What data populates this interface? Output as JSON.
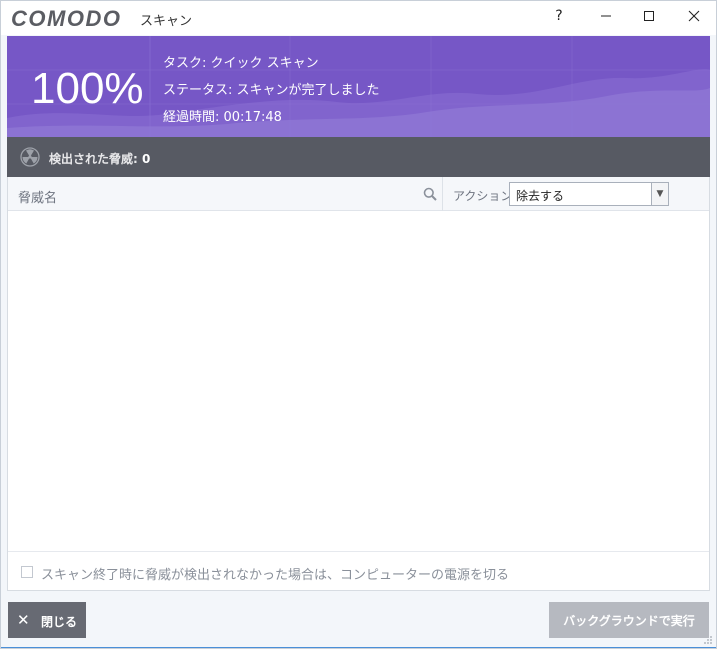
{
  "window": {
    "logo": "COMODO",
    "title": "スキャン",
    "help_label": "?",
    "minimize_label": "─",
    "maximize_label": "☐",
    "close_label": "✕"
  },
  "header": {
    "percent": "100%",
    "task": "タスク: クイック スキャン",
    "status": "ステータス: スキャンが完了しました",
    "elapsed": "経過時間: 00:17:48"
  },
  "threat_bar": {
    "label": "検出された脅威:",
    "count": "0",
    "icon": "radiation-icon"
  },
  "table": {
    "col_threat_name": "脅威名",
    "search_icon": "search-icon",
    "col_action": "アクション",
    "action_selected": "除去する",
    "rows": []
  },
  "options": {
    "shutdown_checkbox_label": "スキャン終了時に脅威が検出されなかった場合は、コンピューターの電源を切る",
    "shutdown_checked": false
  },
  "buttons": {
    "close_icon": "close-icon",
    "close_label": "閉じる",
    "background_label": "バックグラウンドで実行"
  },
  "colors": {
    "header_purple": "#7657c6",
    "threat_bar": "#575a63",
    "close_button": "#676a73",
    "disabled_button": "#b6b9c0"
  }
}
